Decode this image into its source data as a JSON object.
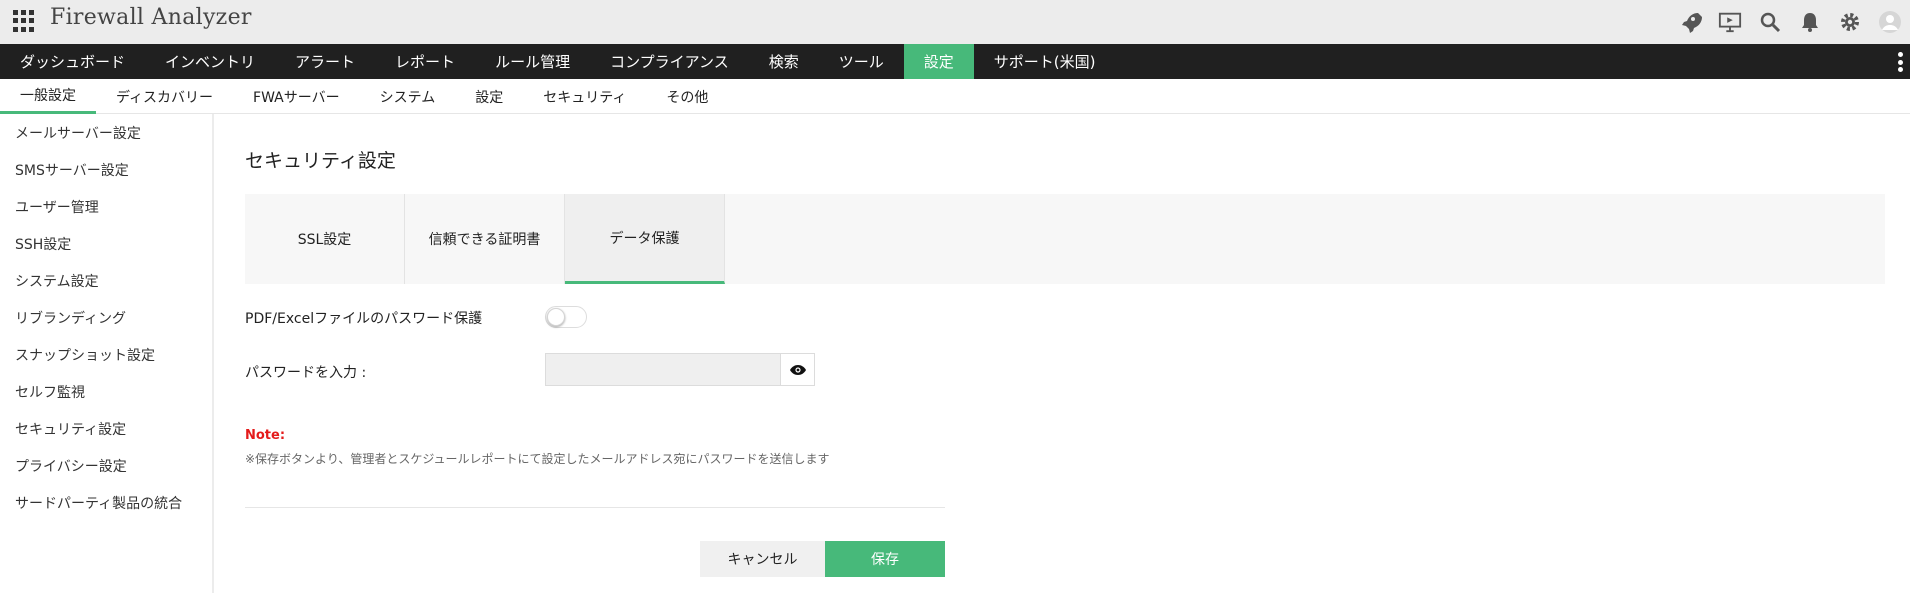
{
  "header": {
    "app_title": "Firewall Analyzer",
    "icons": [
      "apps-grid-icon",
      "rocket-icon",
      "presentation-icon",
      "search-icon",
      "bell-icon",
      "gear-icon",
      "user-avatar-icon"
    ]
  },
  "main_nav": {
    "items": [
      {
        "label": "ダッシュボード"
      },
      {
        "label": "インベントリ"
      },
      {
        "label": "アラート"
      },
      {
        "label": "レポート"
      },
      {
        "label": "ルール管理"
      },
      {
        "label": "コンプライアンス"
      },
      {
        "label": "検索"
      },
      {
        "label": "ツール"
      },
      {
        "label": "設定",
        "active": true
      },
      {
        "label": "サポート(米国)"
      }
    ]
  },
  "sub_nav": {
    "items": [
      {
        "label": "一般設定",
        "active": true
      },
      {
        "label": "ディスカバリー"
      },
      {
        "label": "FWAサーバー"
      },
      {
        "label": "システム"
      },
      {
        "label": "設定"
      },
      {
        "label": "セキュリティ"
      },
      {
        "label": "その他"
      }
    ]
  },
  "sidebar": {
    "items": [
      {
        "label": "メールサーバー設定"
      },
      {
        "label": "SMSサーバー設定"
      },
      {
        "label": "ユーザー管理"
      },
      {
        "label": "SSH設定"
      },
      {
        "label": "システム設定"
      },
      {
        "label": "リブランディング"
      },
      {
        "label": "スナップショット設定"
      },
      {
        "label": "セルフ監視"
      },
      {
        "label": "セキュリティ設定"
      },
      {
        "label": "プライバシー設定"
      },
      {
        "label": "サードパーティ製品の統合"
      }
    ]
  },
  "content": {
    "title": "セキュリティ設定",
    "tabs": [
      {
        "label": "SSL設定"
      },
      {
        "label": "信頼できる証明書"
      },
      {
        "label": "データ保護",
        "active": true
      }
    ],
    "password_protection_label": "PDF/Excelファイルのパスワード保護",
    "password_protection_enabled": false,
    "password_label": "パスワードを入力 :",
    "password_value": "",
    "note_label": "Note:",
    "note_text": "※保存ボタンより、管理者とスケジュールレポートにて設定したメールアドレス宛にパスワードを送信します",
    "cancel_label": "キャンセル",
    "save_label": "保存"
  },
  "colors": {
    "accent": "#47b97a",
    "nav_bg": "#202020",
    "header_bg": "#ececec",
    "note_red": "#e41b1b"
  }
}
